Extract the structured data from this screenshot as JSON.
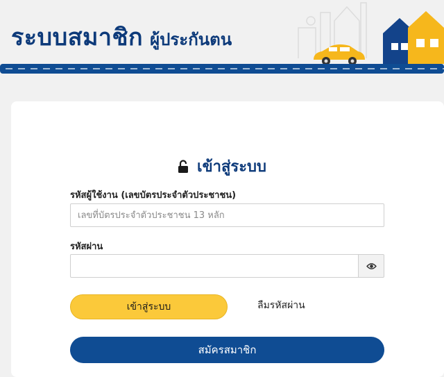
{
  "header": {
    "title_main": "ระบบสมาชิก",
    "title_sub": "ผู้ประกันตน"
  },
  "login": {
    "title": "เข้าสู่ระบบ",
    "username_label": "รหัสผู้ใช้งาน (เลขบัตรประจำตัวประชาชน)",
    "username_placeholder": "เลขที่บัตรประจำตัวประชาชน 13 หลัก",
    "username_value": "",
    "password_label": "รหัสผ่าน",
    "password_value": "",
    "login_button": "เข้าสู่ระบบ",
    "forgot_password": "ลืมรหัสผ่าน",
    "register_button": "สมัครสมาชิก"
  },
  "icons": {
    "lock": "unlock-icon",
    "eye": "eye-icon"
  },
  "colors": {
    "brand_navy": "#0d3a7a",
    "accent_yellow": "#fbc93a",
    "register_blue": "#0f4c93"
  }
}
